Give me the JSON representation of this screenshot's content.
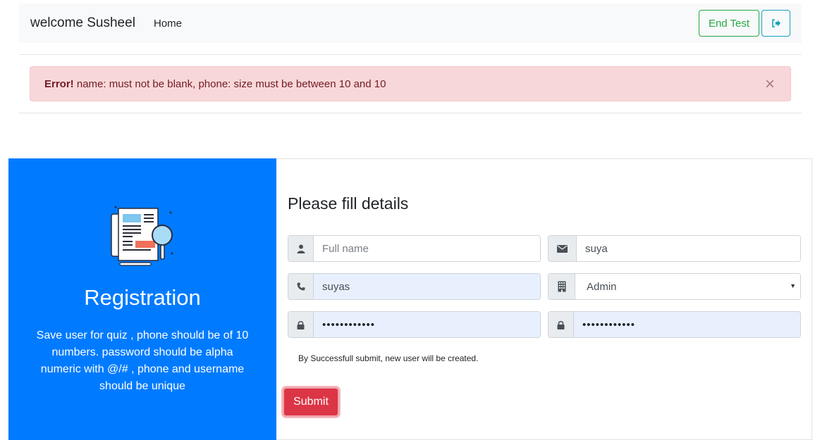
{
  "navbar": {
    "brand": "welcome Susheel",
    "home_label": "Home",
    "end_test_label": "End Test"
  },
  "alert": {
    "prefix": "Error!",
    "message": " name: must not be blank, phone: size must be between 10 and 10",
    "close": "×"
  },
  "left_panel": {
    "title": "Registration",
    "description": "Save user for quiz , phone should be of 10 numbers. password should be alpha numeric with @/# , phone and username should be unique"
  },
  "form": {
    "title": "Please fill details",
    "name_placeholder": "Full name",
    "name_value": "",
    "username_value": "suya",
    "phone_value": "suyas",
    "role_selected": "Admin",
    "password_masked": "••••••••••••",
    "confirm_password_masked": "••••••••••••",
    "hint": "By Successfull submit, new user will be created.",
    "submit_label": "Submit"
  },
  "colors": {
    "primary": "#007bff",
    "danger": "#dc3545",
    "success": "#28a745",
    "info": "#17a2b8",
    "alert_bg": "#f8d7da"
  }
}
